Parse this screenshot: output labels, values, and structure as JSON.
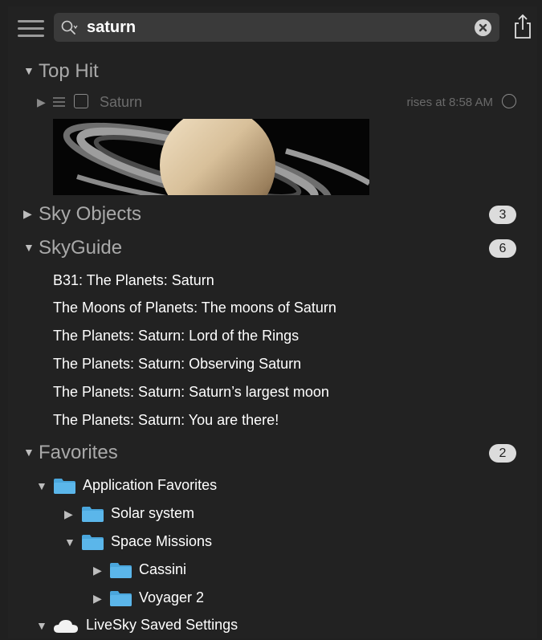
{
  "toolbar": {
    "search_value": "saturn"
  },
  "sections": {
    "top_hit": {
      "title": "Top Hit",
      "object_name": "Saturn",
      "rise_text": "rises at 8:58 AM"
    },
    "sky_objects": {
      "title": "Sky Objects",
      "count": "3"
    },
    "skyguide": {
      "title": "SkyGuide",
      "count": "6",
      "items": [
        "B31: The Planets: Saturn",
        "The Moons of Planets: The moons of Saturn",
        "The Planets: Saturn: Lord of the Rings",
        "The Planets: Saturn: Observing Saturn",
        "The Planets: Saturn: Saturn’s largest moon",
        "The Planets: Saturn: You are there!"
      ]
    },
    "favorites": {
      "title": "Favorites",
      "count": "2",
      "tree": [
        "Application Favorites",
        "Solar system",
        "Space Missions",
        "Cassini",
        "Voyager 2",
        "LiveSky Saved Settings"
      ]
    }
  },
  "colors": {
    "background": "#222222",
    "folder": "#4aa6dc",
    "section_title": "#a9a9a9",
    "badge": "#dcdcdc"
  }
}
